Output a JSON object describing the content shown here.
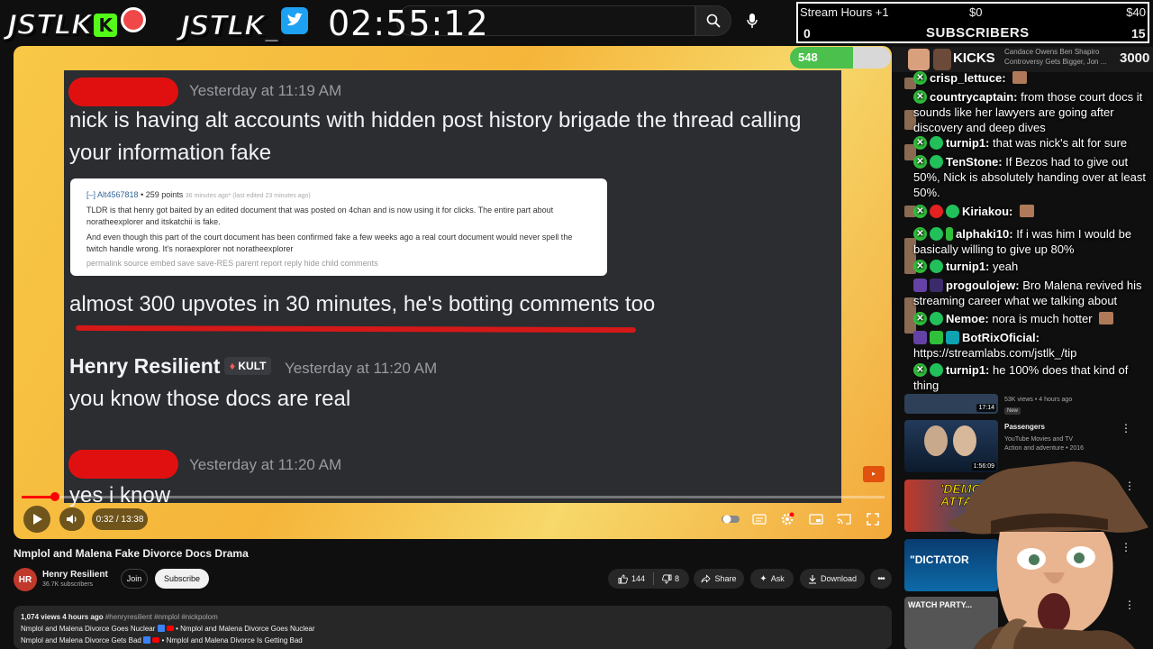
{
  "overlay": {
    "logo_kick": "JSTLK",
    "logo_kick_badge": "K",
    "logo_twitter": "JSTLK_",
    "timer": "02:55:12"
  },
  "stream_hours": {
    "title": "Stream Hours +1",
    "min_label": "$0",
    "max_label": "$40",
    "left_value": "0",
    "center_label": "SUBSCRIBERS",
    "right_value": "15"
  },
  "kicks": {
    "label": "KICKS",
    "desc_line1": "Candace Owens Ben Shapiro",
    "desc_line2": "Controversy Gets Bigger, Jon ...",
    "count": "3000"
  },
  "counter_badge": "548",
  "video_content": {
    "msg1_time": "Yesterday at 11:19 AM",
    "msg1_text_l1": "nick is having alt accounts with hidden post history brigade the thread calling",
    "msg1_text_l2": "your information fake",
    "reddit_meta_user": "[–] Alt4567818",
    "reddit_meta_points": "• 259 points",
    "reddit_meta_time": "36 minutes ago* (last edited 23 minutes ago)",
    "reddit_p1": "TLDR is that henry got baited by an edited document that was posted on 4chan and is now using it for clicks. The entire part about noratheexplorer and itskatchii is fake.",
    "reddit_p2": "And even though this part of the court document has been confirmed fake a few weeks ago a real court document would never spell the twitch handle wrong. It's noraexplorer not noratheexplorer",
    "reddit_links": "permalink   source   embed   save   save-RES   parent   report   reply   hide child comments",
    "msg2_text": "almost 300 upvotes in 30 minutes, he's botting comments too",
    "user3": "Henry Resilient",
    "user3_tag": "KULT",
    "msg3_time": "Yesterday at 11:20 AM",
    "msg3_text": "you know those docs are real",
    "msg4_time": "Yesterday at 11:20 AM",
    "msg4_text": "yes i know"
  },
  "player": {
    "time": "0:32 / 13:38",
    "progress": 0.039
  },
  "video": {
    "title": "Nmplol and Malena Fake Divorce Docs Drama",
    "channel": "Henry Resilient",
    "subs": "36.7K subscribers",
    "join": "Join",
    "subscribe": "Subscribe",
    "likes": "144",
    "dislikes": "8",
    "share": "Share",
    "ask": "Ask",
    "download": "Download",
    "views_line": "1,074 views  4 hours ago",
    "tags": "#henryresilient #nmplol #nickpolom",
    "desc1_a": "Nmplol and Malena Divorce Goes Nuclear",
    "desc1_b": "• Nmplol and Malena Divorce Goes Nuclear",
    "desc2_a": "Nmplol and Malena Divorce Gets Bad",
    "desc2_b": "• Nmplol and Malena Divorce Is Getting Bad"
  },
  "recommendations": {
    "rec1_stats": "53K views • 4 hours ago",
    "rec1_badge": "New",
    "rec1_duration": "17:14",
    "rec2_title": "Passengers",
    "rec2_sub1": "YouTube Movies and TV",
    "rec2_sub2": "Action and adventure • 2016",
    "rec2_duration": "1:56:09",
    "rec3_text": "'DEMONS ATTACKED'",
    "rec4_text": "\"DICTATOR",
    "rec5_text": "WATCH PARTY..."
  },
  "chat": [
    {
      "user": "crisp_lettuce:",
      "text": ""
    },
    {
      "user": "countrycaptain:",
      "text": "from those court docs it sounds like her lawyers are going after discovery and deep dives"
    },
    {
      "user": "turnip1:",
      "text": "that was nick's alt for sure"
    },
    {
      "user": "TenStone:",
      "text": "If Bezos had to give out 50%, Nick is absolutely handing over at least 50%."
    },
    {
      "user": "Kiriakou:",
      "text": ""
    },
    {
      "user": "alphaki10:",
      "text": "If i was him I would be basically willing to give up 80%"
    },
    {
      "user": "turnip1:",
      "text": "yeah"
    },
    {
      "user": "progoulojew:",
      "text": "Bro Malena revived his streaming career what we talking about"
    },
    {
      "user": "Nemoe:",
      "text": "nora is much hotter"
    },
    {
      "user": "BotRixOficial:",
      "text": "https://streamlabs.com/jstlk_/tip"
    },
    {
      "user": "turnip1:",
      "text": "he 100% does that kind of thing"
    }
  ]
}
